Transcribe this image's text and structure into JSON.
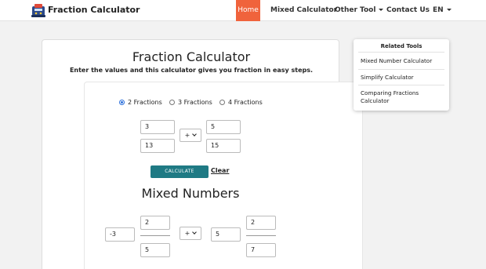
{
  "brand": {
    "name": "Fraction Calculator",
    "logo_icon": "calculator-robot-icon"
  },
  "nav": {
    "home": "Home",
    "mixed": "Mixed Calculator",
    "other": "Other Tool",
    "contact": "Contact Us",
    "lang": "EN"
  },
  "colors": {
    "accent": "#f0633c",
    "button": "#1f7a84"
  },
  "main": {
    "title": "Fraction Calculator",
    "subtitle": "Enter the values and this calculator gives you fraction in easy steps.",
    "options": [
      "2 Fractions",
      "3 Fractions",
      "4 Fractions"
    ],
    "selected_option": "2 Fractions",
    "fraction1": {
      "numerator": "3",
      "denominator": "13"
    },
    "operator": "+",
    "fraction2": {
      "numerator": "5",
      "denominator": "15"
    },
    "calculate_label": "CALCULATE",
    "clear_label": "Clear",
    "mixed_title": "Mixed Numbers",
    "mixed1": {
      "whole": "-3",
      "numerator": "2",
      "denominator": "5"
    },
    "mixed_operator": "+",
    "mixed2": {
      "whole": "5",
      "numerator": "2",
      "denominator": "7"
    }
  },
  "sidebar": {
    "title": "Related Tools",
    "links": [
      "Mixed Number Calculator",
      "Simplify Calculator",
      "Comparing Fractions Calculator"
    ]
  }
}
